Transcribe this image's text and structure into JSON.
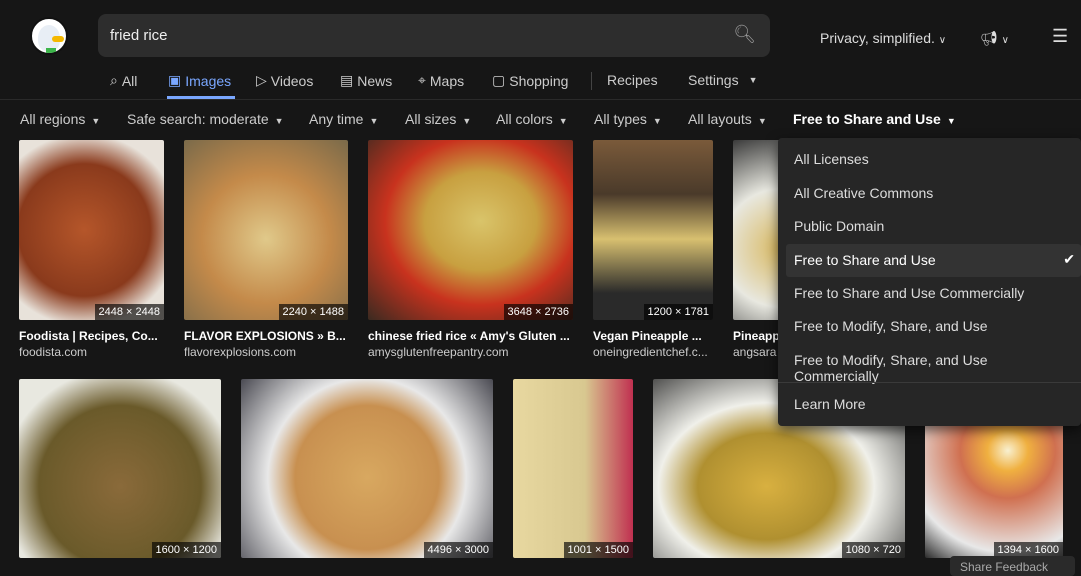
{
  "search": {
    "query": "fried rice",
    "icon": "search-icon"
  },
  "header": {
    "privacy_label": "Privacy, simplified.",
    "announce_icon": "megaphone-icon",
    "menu_icon": "hamburger-icon"
  },
  "nav": [
    {
      "label": "All",
      "icon": "search-icon"
    },
    {
      "label": "Images",
      "icon": "image-icon",
      "active": true
    },
    {
      "label": "Videos",
      "icon": "play-icon"
    },
    {
      "label": "News",
      "icon": "newspaper-icon"
    },
    {
      "label": "Maps",
      "icon": "map-pin-icon"
    },
    {
      "label": "Shopping",
      "icon": "shopping-bag-icon"
    },
    {
      "label": "Recipes"
    },
    {
      "label": "Settings"
    }
  ],
  "filters": [
    "All regions",
    "Safe search: moderate",
    "Any time",
    "All sizes",
    "All colors",
    "All types",
    "All layouts",
    "Free to Share and Use"
  ],
  "license_menu": {
    "items": [
      "All Licenses",
      "All Creative Commons",
      "Public Domain",
      "Free to Share and Use",
      "Free to Share and Use Commercially",
      "Free to Modify, Share, and Use",
      "Free to Modify, Share, and Use Commercially"
    ],
    "selected": "Free to Share and Use",
    "learn_more": "Learn More"
  },
  "results_row1": [
    {
      "title": "Foodista | Recipes, Co...",
      "domain": "foodista.com",
      "dims": "2448 × 2448"
    },
    {
      "title": "FLAVOR EXPLOSIONS » B...",
      "domain": "flavorexplosions.com",
      "dims": "2240 × 1488"
    },
    {
      "title": "chinese fried rice « Amy's Gluten ...",
      "domain": "amysglutenfreepantry.com",
      "dims": "3648 × 2736"
    },
    {
      "title": "Vegan Pineapple ...",
      "domain": "oneingredientchef.c...",
      "dims": "1200 × 1781"
    },
    {
      "title": "Pineapp",
      "domain": "angsara",
      "dims": ""
    }
  ],
  "results_row2": [
    {
      "dims": "1600 × 1200"
    },
    {
      "dims": "4496 × 3000"
    },
    {
      "dims": "1001 × 1500"
    },
    {
      "dims": "1080 × 720"
    },
    {
      "dims": "1394 × 1600"
    }
  ],
  "feedback_label": "Share Feedback",
  "colors": {
    "accent": "#7aa7ff",
    "background": "#161616"
  }
}
